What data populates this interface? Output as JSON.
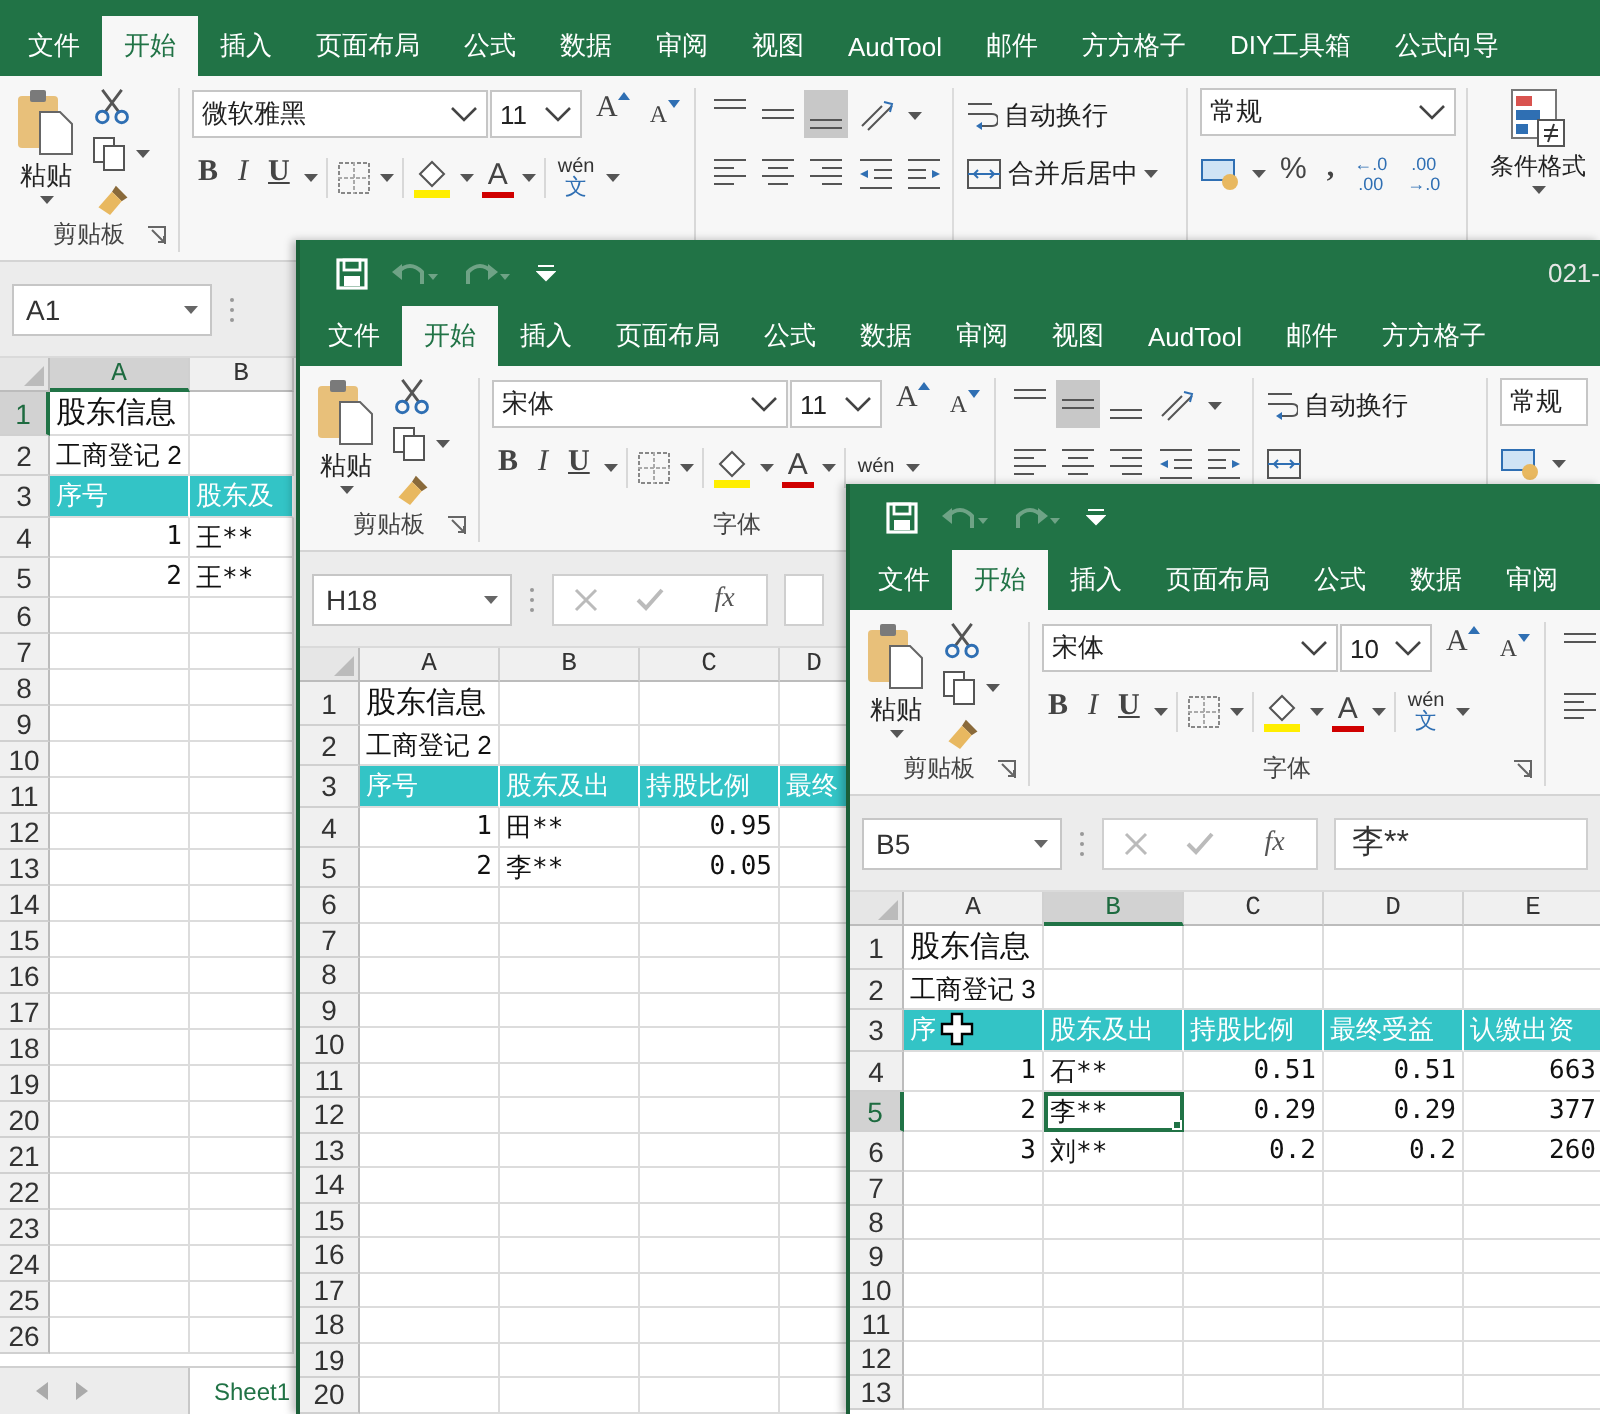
{
  "windows": [
    {
      "quick_access": false,
      "tabs": [
        {
          "label": "文件",
          "selected": false
        },
        {
          "label": "开始",
          "selected": true
        },
        {
          "label": "插入",
          "selected": false
        },
        {
          "label": "页面布局",
          "selected": false
        },
        {
          "label": "公式",
          "selected": false
        },
        {
          "label": "数据",
          "selected": false
        },
        {
          "label": "审阅",
          "selected": false
        },
        {
          "label": "视图",
          "selected": false
        },
        {
          "label": "AudTool",
          "selected": false
        },
        {
          "label": "邮件",
          "selected": false
        },
        {
          "label": "方方格子",
          "selected": false
        },
        {
          "label": "DIY工具箱",
          "selected": false
        },
        {
          "label": "公式向导",
          "selected": false
        }
      ],
      "ribbon": [
        {
          "kind": "clipboard",
          "paste": "粘贴",
          "label": "剪贴板"
        },
        {
          "kind": "font",
          "font": "微软雅黑",
          "size": "11",
          "grow": "A",
          "shrink": "A",
          "bold": "B",
          "italic": "I",
          "underline": "U",
          "color_glyph": "A",
          "phonetic": "wén",
          "phonetic_char": "文"
        },
        {
          "kind": "alignment",
          "vertical_aligns": [
            {
              "kind": "top",
              "selected": false
            },
            {
              "kind": "middle",
              "selected": false
            },
            {
              "kind": "bottom",
              "selected": true
            }
          ],
          "wrap": "自动换行",
          "merge": "合并后居中"
        },
        {
          "kind": "number",
          "format": "常规",
          "percent": "%",
          "comma": ",",
          "increase_decimal": [
            "←.0",
            ".00"
          ],
          "decrease_decimal": [
            ".00",
            "→.0"
          ]
        },
        {
          "kind": "styles",
          "conditional": "条件格式"
        }
      ],
      "name_box": "A1",
      "columns": [
        {
          "label": "A",
          "selected": true
        },
        {
          "label": "B",
          "selected": false
        }
      ],
      "rows": [
        {
          "header": "1",
          "selected": true,
          "kind": "title",
          "cells": [
            {
              "text": "股东信息",
              "kind": "text",
              "selected": false
            },
            null
          ]
        },
        {
          "header": "2",
          "selected": false,
          "kind": "note",
          "cells": [
            {
              "text": "工商登记 2",
              "kind": "text",
              "selected": false
            },
            null
          ]
        },
        {
          "header": "3",
          "selected": false,
          "kind": "head",
          "cells": [
            {
              "text": "序号",
              "kind": "text",
              "selected": false
            },
            {
              "text": "股东及",
              "kind": "text",
              "selected": false
            }
          ]
        },
        {
          "header": "4",
          "selected": false,
          "kind": "data",
          "cells": [
            {
              "text": "1",
              "kind": "number",
              "selected": false
            },
            {
              "text": "王**",
              "kind": "text",
              "selected": false
            }
          ]
        },
        {
          "header": "5",
          "selected": false,
          "kind": "data",
          "cells": [
            {
              "text": "2",
              "kind": "number",
              "selected": false
            },
            {
              "text": "王**",
              "kind": "text",
              "selected": false
            }
          ]
        },
        {
          "header": "6",
          "selected": false,
          "kind": "empty"
        },
        {
          "header": "7",
          "selected": false,
          "kind": "empty"
        },
        {
          "header": "8",
          "selected": false,
          "kind": "empty"
        },
        {
          "header": "9",
          "selected": false,
          "kind": "empty"
        },
        {
          "header": "10",
          "selected": false,
          "kind": "empty"
        },
        {
          "header": "11",
          "selected": false,
          "kind": "empty"
        },
        {
          "header": "12",
          "selected": false,
          "kind": "empty"
        },
        {
          "header": "13",
          "selected": false,
          "kind": "empty"
        },
        {
          "header": "14",
          "selected": false,
          "kind": "empty"
        },
        {
          "header": "15",
          "selected": false,
          "kind": "empty"
        },
        {
          "header": "16",
          "selected": false,
          "kind": "empty"
        },
        {
          "header": "17",
          "selected": false,
          "kind": "empty"
        },
        {
          "header": "18",
          "selected": false,
          "kind": "empty"
        },
        {
          "header": "19",
          "selected": false,
          "kind": "empty"
        },
        {
          "header": "20",
          "selected": false,
          "kind": "empty"
        },
        {
          "header": "21",
          "selected": false,
          "kind": "empty"
        },
        {
          "header": "22",
          "selected": false,
          "kind": "empty"
        },
        {
          "header": "23",
          "selected": false,
          "kind": "empty"
        },
        {
          "header": "24",
          "selected": false,
          "kind": "empty"
        },
        {
          "header": "25",
          "selected": false,
          "kind": "empty"
        },
        {
          "header": "26",
          "selected": false,
          "kind": "empty"
        }
      ],
      "sheet_tabs": [
        {
          "label": "Sheet1",
          "selected": true
        }
      ]
    },
    {
      "quick_access": true,
      "title": "021-",
      "tabs": [
        {
          "label": "文件",
          "selected": false
        },
        {
          "label": "开始",
          "selected": true
        },
        {
          "label": "插入",
          "selected": false
        },
        {
          "label": "页面布局",
          "selected": false
        },
        {
          "label": "公式",
          "selected": false
        },
        {
          "label": "数据",
          "selected": false
        },
        {
          "label": "审阅",
          "selected": false
        },
        {
          "label": "视图",
          "selected": false
        },
        {
          "label": "AudTool",
          "selected": false
        },
        {
          "label": "邮件",
          "selected": false
        },
        {
          "label": "方方格子",
          "selected": false
        }
      ],
      "ribbon": [
        {
          "kind": "clipboard",
          "paste": "粘贴",
          "label": "剪贴板"
        },
        {
          "kind": "font",
          "font": "宋体",
          "size": "11",
          "grow": "A",
          "shrink": "A",
          "bold": "B",
          "italic": "I",
          "underline": "U",
          "color_glyph": "A",
          "phonetic": "wén",
          "label": "字体"
        },
        {
          "kind": "alignment",
          "vertical_aligns": [
            {
              "kind": "top",
              "selected": false
            },
            {
              "kind": "middle",
              "selected": true
            },
            {
              "kind": "bottom",
              "selected": false
            }
          ],
          "wrap": "自动换行"
        },
        {
          "kind": "number",
          "format": "常规"
        }
      ],
      "name_box": "H18",
      "fx": "fx",
      "columns": [
        {
          "label": "A",
          "selected": false
        },
        {
          "label": "B",
          "selected": false
        },
        {
          "label": "C",
          "selected": false
        },
        {
          "label": "D",
          "selected": false
        }
      ],
      "rows": [
        {
          "header": "1",
          "selected": false,
          "kind": "title",
          "cells": [
            {
              "text": "股东信息",
              "kind": "text",
              "selected": false
            },
            null,
            null,
            null
          ]
        },
        {
          "header": "2",
          "selected": false,
          "kind": "note",
          "cells": [
            {
              "text": "工商登记 2",
              "kind": "text",
              "selected": false
            },
            null,
            null,
            null
          ]
        },
        {
          "header": "3",
          "selected": false,
          "kind": "head",
          "cells": [
            {
              "text": "序号",
              "kind": "text",
              "selected": false
            },
            {
              "text": "股东及出",
              "kind": "text",
              "selected": false
            },
            {
              "text": "持股比例",
              "kind": "text",
              "selected": false
            },
            {
              "text": "最终",
              "kind": "text",
              "selected": false
            }
          ]
        },
        {
          "header": "4",
          "selected": false,
          "kind": "data",
          "cells": [
            {
              "text": "1",
              "kind": "number",
              "selected": false
            },
            {
              "text": "田**",
              "kind": "text",
              "selected": false
            },
            {
              "text": "0.95",
              "kind": "number",
              "selected": false
            },
            null
          ]
        },
        {
          "header": "5",
          "selected": false,
          "kind": "data",
          "cells": [
            {
              "text": "2",
              "kind": "number",
              "selected": false
            },
            {
              "text": "李**",
              "kind": "text",
              "selected": false
            },
            {
              "text": "0.05",
              "kind": "number",
              "selected": false
            },
            null
          ]
        },
        {
          "header": "6",
          "selected": false,
          "kind": "empty"
        },
        {
          "header": "7",
          "selected": false,
          "kind": "empty"
        },
        {
          "header": "8",
          "selected": false,
          "kind": "empty"
        },
        {
          "header": "9",
          "selected": false,
          "kind": "empty"
        },
        {
          "header": "10",
          "selected": false,
          "kind": "empty"
        },
        {
          "header": "11",
          "selected": false,
          "kind": "empty"
        },
        {
          "header": "12",
          "selected": false,
          "kind": "empty"
        },
        {
          "header": "13",
          "selected": false,
          "kind": "empty"
        },
        {
          "header": "14",
          "selected": false,
          "kind": "empty"
        },
        {
          "header": "15",
          "selected": false,
          "kind": "empty"
        },
        {
          "header": "16",
          "selected": false,
          "kind": "empty"
        },
        {
          "header": "17",
          "selected": false,
          "kind": "empty"
        },
        {
          "header": "18",
          "selected": false,
          "kind": "empty"
        },
        {
          "header": "19",
          "selected": false,
          "kind": "empty"
        },
        {
          "header": "20",
          "selected": false,
          "kind": "empty"
        }
      ]
    },
    {
      "quick_access": true,
      "tabs": [
        {
          "label": "文件",
          "selected": false
        },
        {
          "label": "开始",
          "selected": true
        },
        {
          "label": "插入",
          "selected": false
        },
        {
          "label": "页面布局",
          "selected": false
        },
        {
          "label": "公式",
          "selected": false
        },
        {
          "label": "数据",
          "selected": false
        },
        {
          "label": "审阅",
          "selected": false
        }
      ],
      "ribbon": [
        {
          "kind": "clipboard",
          "paste": "粘贴",
          "label": "剪贴板"
        },
        {
          "kind": "font",
          "font": "宋体",
          "size": "10",
          "grow": "A",
          "shrink": "A",
          "bold": "B",
          "italic": "I",
          "underline": "U",
          "color_glyph": "A",
          "phonetic": "wén",
          "phonetic_char": "文",
          "label": "字体",
          "dialog_launcher": true
        },
        {
          "kind": "alignment"
        }
      ],
      "name_box": "B5",
      "fx": "fx",
      "formula": "李**",
      "columns": [
        {
          "label": "A",
          "selected": false
        },
        {
          "label": "B",
          "selected": true
        },
        {
          "label": "C",
          "selected": false
        },
        {
          "label": "D",
          "selected": false
        },
        {
          "label": "E",
          "selected": false
        }
      ],
      "rows": [
        {
          "header": "1",
          "selected": false,
          "kind": "title",
          "cells": [
            {
              "text": "股东信息",
              "kind": "text",
              "selected": false
            },
            null,
            null,
            null,
            null
          ]
        },
        {
          "header": "2",
          "selected": false,
          "kind": "note",
          "cells": [
            {
              "text": "工商登记 3",
              "kind": "text",
              "selected": false
            },
            null,
            null,
            null,
            null
          ]
        },
        {
          "header": "3",
          "selected": false,
          "kind": "head",
          "cells": [
            {
              "text": "序",
              "kind": "text",
              "selected": false,
              "cursor": true
            },
            {
              "text": "股东及出",
              "kind": "text",
              "selected": false
            },
            {
              "text": "持股比例",
              "kind": "text",
              "selected": false
            },
            {
              "text": "最终受益",
              "kind": "text",
              "selected": false
            },
            {
              "text": "认缴出资",
              "kind": "text",
              "selected": false
            }
          ]
        },
        {
          "header": "4",
          "selected": false,
          "kind": "data",
          "cells": [
            {
              "text": "1",
              "kind": "number",
              "selected": false
            },
            {
              "text": "石**",
              "kind": "text",
              "selected": false
            },
            {
              "text": "0.51",
              "kind": "number",
              "selected": false
            },
            {
              "text": "0.51",
              "kind": "number",
              "selected": false
            },
            {
              "text": "663",
              "kind": "number",
              "selected": false
            }
          ]
        },
        {
          "header": "5",
          "selected": true,
          "kind": "data",
          "cells": [
            {
              "text": "2",
              "kind": "number",
              "selected": false
            },
            {
              "text": "李**",
              "kind": "text",
              "selected": true
            },
            {
              "text": "0.29",
              "kind": "number",
              "selected": false
            },
            {
              "text": "0.29",
              "kind": "number",
              "selected": false
            },
            {
              "text": "377",
              "kind": "number",
              "selected": false
            }
          ]
        },
        {
          "header": "6",
          "selected": false,
          "kind": "data",
          "cells": [
            {
              "text": "3",
              "kind": "number",
              "selected": false
            },
            {
              "text": "刘**",
              "kind": "text",
              "selected": false
            },
            {
              "text": "0.2",
              "kind": "number",
              "selected": false
            },
            {
              "text": "0.2",
              "kind": "number",
              "selected": false
            },
            {
              "text": "260",
              "kind": "number",
              "selected": false
            }
          ]
        },
        {
          "header": "7",
          "selected": false,
          "kind": "empty"
        },
        {
          "header": "8",
          "selected": false,
          "kind": "empty"
        },
        {
          "header": "9",
          "selected": false,
          "kind": "empty"
        },
        {
          "header": "10",
          "selected": false,
          "kind": "empty"
        },
        {
          "header": "11",
          "selected": false,
          "kind": "empty"
        },
        {
          "header": "12",
          "selected": false,
          "kind": "empty"
        },
        {
          "header": "13",
          "selected": false,
          "kind": "empty"
        }
      ]
    }
  ]
}
